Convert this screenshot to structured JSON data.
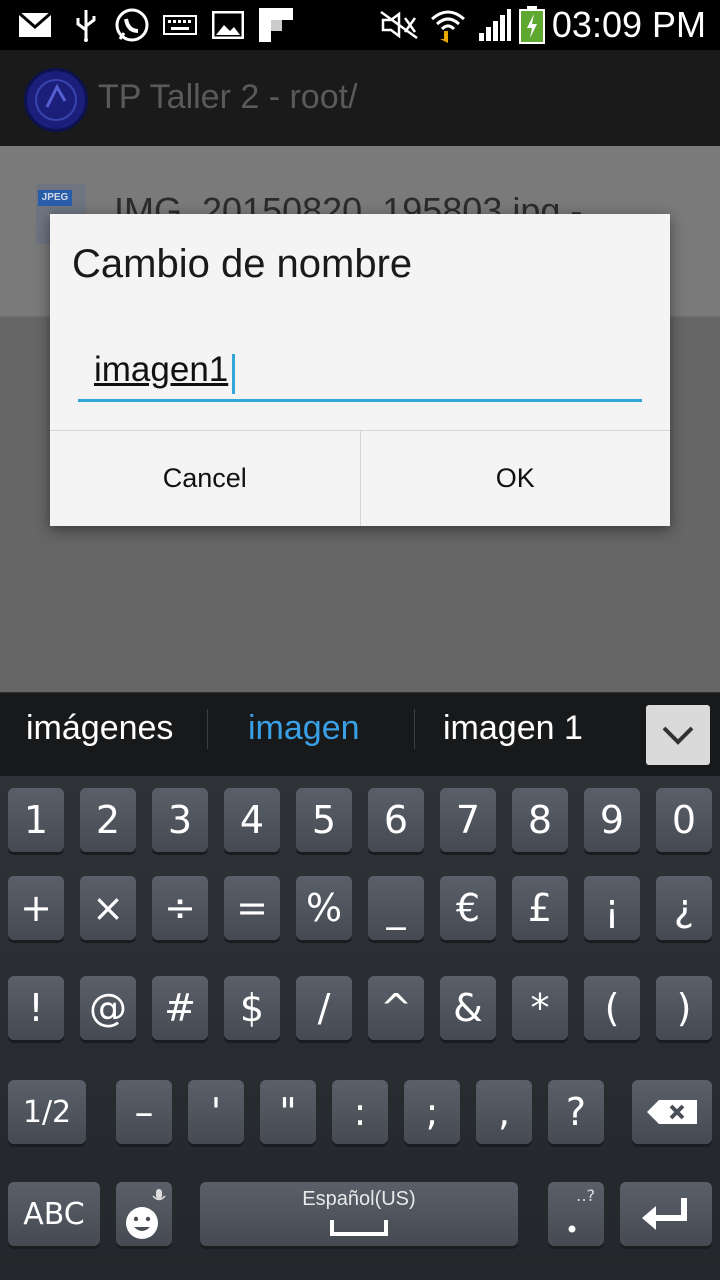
{
  "status_bar": {
    "time": "03:09 PM",
    "icons": [
      "mail-icon",
      "usb-icon",
      "whatsapp-icon",
      "keyboard-icon",
      "image-icon",
      "flipboard-icon",
      "mute-icon",
      "wifi-icon",
      "signal-icon",
      "battery-charging-icon"
    ]
  },
  "action_bar": {
    "title": "TP Taller 2 - root/"
  },
  "list": {
    "items": [
      {
        "name": "IMG_20150820_195803.jpg -",
        "icon_tag": "JPEG"
      }
    ]
  },
  "dialog": {
    "title": "Cambio de nombre",
    "input_value": "imagen1",
    "cancel_label": "Cancel",
    "ok_label": "OK"
  },
  "keyboard": {
    "suggestions": [
      "imágenes",
      "imagen",
      "imagen 1"
    ],
    "row1": [
      "1",
      "2",
      "3",
      "4",
      "5",
      "6",
      "7",
      "8",
      "9",
      "0"
    ],
    "row2": [
      "+",
      "×",
      "÷",
      "=",
      "%",
      "_",
      "€",
      "£",
      "¡",
      "¿"
    ],
    "row3": [
      "!",
      "@",
      "#",
      "$",
      "/",
      "^",
      "&",
      "*",
      "(",
      ")"
    ],
    "row4": [
      "1/2",
      "–",
      "'",
      "\"",
      ":",
      ";",
      ",",
      "?"
    ],
    "abc_label": "ABC",
    "space_label": "Español(US)",
    "accent_color": "#3aa0e6"
  }
}
